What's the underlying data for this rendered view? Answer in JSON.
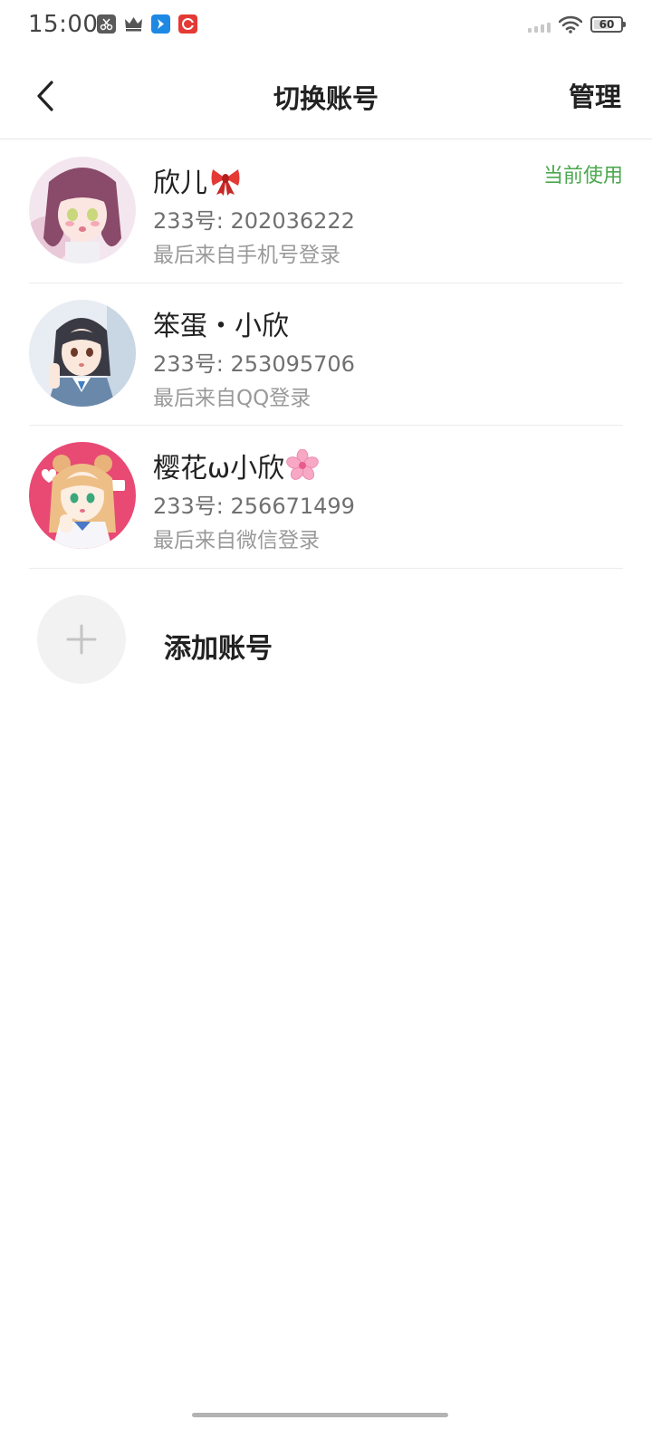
{
  "status_bar": {
    "time": "15:00",
    "battery_level": "60",
    "battery_fraction": 0.6,
    "app_icons": [
      "scissors-app-icon",
      "crown-app-icon",
      "blue-app-icon",
      "red-app-icon"
    ]
  },
  "header": {
    "title": "切换账号",
    "manage_label": "管理"
  },
  "accounts": [
    {
      "name": "欣儿",
      "name_emoji": "ribbon-icon",
      "id_text": "233号: 202036222",
      "login_text": "最后来自手机号登录",
      "status": "当前使用"
    },
    {
      "name": "笨蛋・小欣",
      "name_emoji": "",
      "id_text": "233号: 253095706",
      "login_text": "最后来自QQ登录",
      "status": ""
    },
    {
      "name": "樱花ω小欣",
      "name_emoji": "cherry-blossom-icon",
      "id_text": "233号: 256671499",
      "login_text": "最后来自微信登录",
      "status": ""
    }
  ],
  "add_account": {
    "label": "添加账号"
  },
  "colors": {
    "accent_green": "#4aa84e",
    "divider": "#ececec",
    "text_primary": "#222222",
    "text_secondary": "#707070"
  }
}
